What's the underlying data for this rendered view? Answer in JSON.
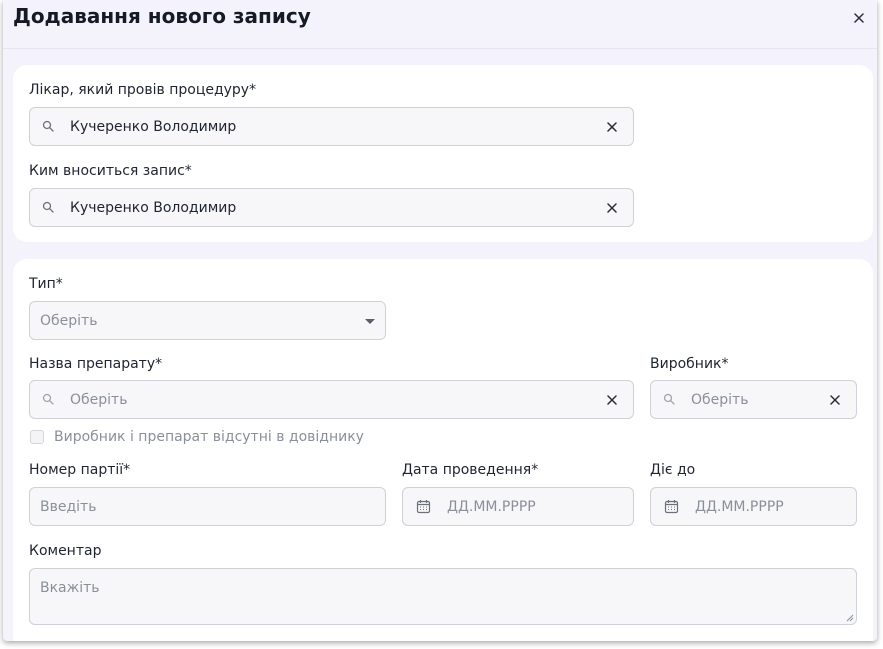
{
  "modal": {
    "title": "Додавання нового запису",
    "close_icon": "close-icon"
  },
  "performer": {
    "doctor_label": "Лікар, який провів процедуру*",
    "doctor_value": "Кучеренко Володимир",
    "entered_by_label": "Ким вноситься запис*",
    "entered_by_value": "Кучеренко Володимир"
  },
  "form": {
    "type_label": "Тип*",
    "type_placeholder": "Оберіть",
    "drug_label": "Назва препарату*",
    "drug_placeholder": "Оберіть",
    "manufacturer_label": "Виробник*",
    "manufacturer_placeholder": "Оберіть",
    "missing_checkbox_label": "Виробник і препарат відсутні в довіднику",
    "batch_label": "Номер партії*",
    "batch_placeholder": "Введіть",
    "date_label": "Дата проведення*",
    "date_placeholder": "ДД.ММ.РРРР",
    "valid_until_label": "Діє до",
    "valid_until_placeholder": "ДД.ММ.РРРР",
    "comment_label": "Коментар",
    "comment_placeholder": "Вкажіть"
  }
}
